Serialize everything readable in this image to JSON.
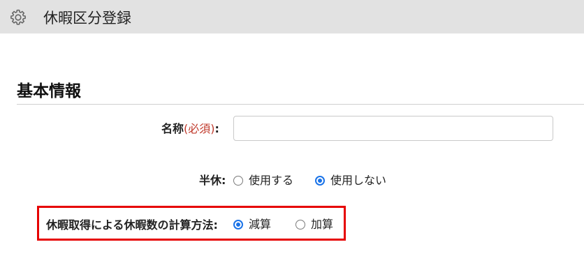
{
  "header": {
    "title": "休暇区分登録",
    "icon": "gear-icon"
  },
  "section": {
    "title": "基本情報"
  },
  "form": {
    "name": {
      "label": "名称",
      "required_text": "(必須)",
      "colon": ":",
      "value": "",
      "placeholder": ""
    },
    "half_day": {
      "label": "半休:",
      "options": [
        {
          "label": "使用する",
          "checked": false
        },
        {
          "label": "使用しない",
          "checked": true
        }
      ]
    },
    "calc_method": {
      "label": "休暇取得による休暇数の計算方法:",
      "options": [
        {
          "label": "減算",
          "checked": true
        },
        {
          "label": "加算",
          "checked": false
        }
      ]
    }
  },
  "colors": {
    "accent": "#1a73e8",
    "required": "#c0392b",
    "highlight": "#e60000",
    "header_bg": "#e2e2e2"
  }
}
